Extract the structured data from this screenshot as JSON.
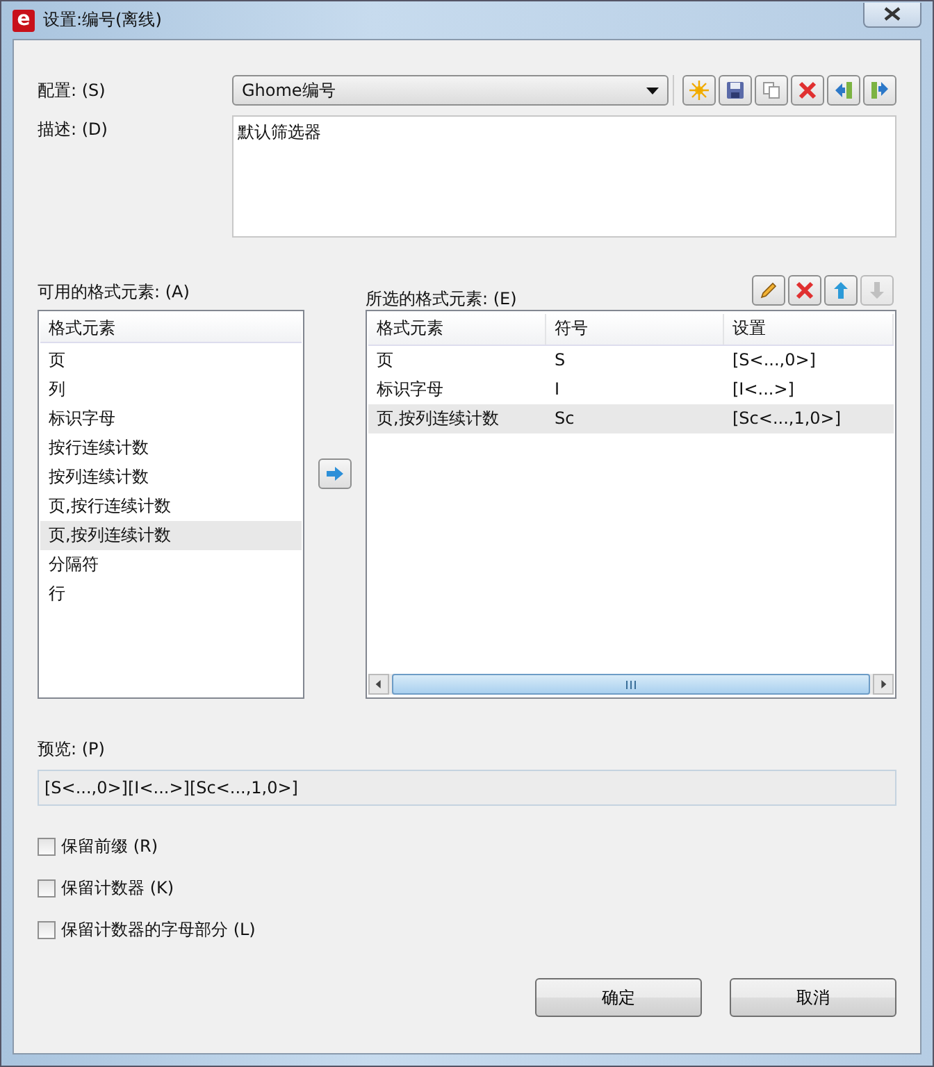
{
  "window": {
    "title": "设置:编号(离线)",
    "logo": "e"
  },
  "config": {
    "label": "配置: (S)",
    "value": "Ghome编号",
    "tools": [
      {
        "kind": "new"
      },
      {
        "kind": "save"
      },
      {
        "kind": "copy"
      },
      {
        "kind": "delete"
      },
      {
        "kind": "import"
      },
      {
        "kind": "export"
      }
    ]
  },
  "description": {
    "label": "描述: (D)",
    "value": "默认筛选器"
  },
  "available": {
    "label": "可用的格式元素: (A)",
    "column": "格式元素",
    "items": [
      {
        "text": "页",
        "selected": false
      },
      {
        "text": "列",
        "selected": false
      },
      {
        "text": "标识字母",
        "selected": false
      },
      {
        "text": "按行连续计数",
        "selected": false
      },
      {
        "text": "按列连续计数",
        "selected": false
      },
      {
        "text": "页,按行连续计数",
        "selected": false
      },
      {
        "text": "页,按列连续计数",
        "selected": true
      },
      {
        "text": "分隔符",
        "selected": false
      },
      {
        "text": "行",
        "selected": false
      }
    ]
  },
  "selected_elements": {
    "label": "所选的格式元素: (E)",
    "tools": [
      {
        "kind": "edit",
        "disabled": false
      },
      {
        "kind": "delete",
        "disabled": false
      },
      {
        "kind": "up",
        "disabled": false
      },
      {
        "kind": "down",
        "disabled": true
      }
    ],
    "columns": [
      "格式元素",
      "符号",
      "设置"
    ],
    "rows": [
      {
        "cells": [
          "页",
          "S",
          "[S<...,0>]"
        ],
        "selected": false
      },
      {
        "cells": [
          "标识字母",
          "I",
          "[I<...>]"
        ],
        "selected": false
      },
      {
        "cells": [
          "页,按列连续计数",
          "Sc",
          "[Sc<...,1,0>]"
        ],
        "selected": true
      }
    ]
  },
  "preview": {
    "label": "预览: (P)",
    "value": "[S<...,0>][I<...>][Sc<...,1,0>]"
  },
  "options": [
    {
      "label": "保留前缀 (R)",
      "checked": false
    },
    {
      "label": "保留计数器 (K)",
      "checked": false
    },
    {
      "label": "保留计数器的字母部分 (L)",
      "checked": false
    }
  ],
  "buttons": [
    "确定",
    "取消"
  ]
}
